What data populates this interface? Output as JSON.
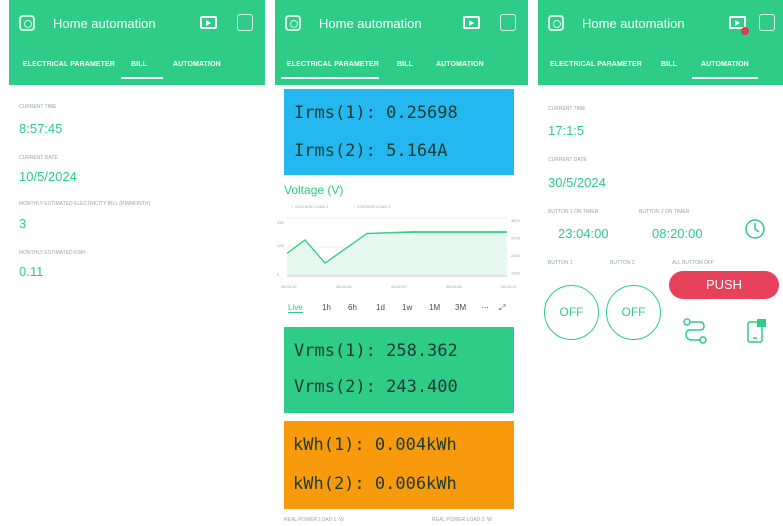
{
  "colors": {
    "accent": "#2ecc87",
    "lcd_blue": "#25b8f0",
    "lcd_green": "#2ecc87",
    "lcd_orange": "#f99a0c",
    "push": "#e8415c"
  },
  "app": {
    "title": "Home automation"
  },
  "tabs": [
    "ELECTRICAL PARAMETER",
    "BILL",
    "AUTOMATION"
  ],
  "bill": {
    "current_time_label": "CURRENT TIME",
    "current_time": "8:57:45",
    "current_date_label": "CURRENT DATE",
    "current_date": "10/5/2024",
    "bill_label": "MONTHLY ESTIMATED ELECTRICITY BILL (RM/MONTH)",
    "bill_value": "3",
    "kwh_label": "MONTHLY ESTIMATED KWH",
    "kwh_value": "0.11"
  },
  "electrical": {
    "irms1": "Irms(1): 0.25698",
    "irms2": "Irms(2): 5.164A",
    "chart_title": "Voltage (V)",
    "legend1": "VOLTAGE LOAD 1",
    "legend2": "VOLTAGE LOAD 2",
    "ranges": [
      "Live",
      "1h",
      "6h",
      "1d",
      "1w",
      "1M",
      "3M"
    ],
    "vrms1": "Vrms(1): 258.362",
    "vrms2": "Vrms(2): 243.400",
    "kwh1": "kWh(1): 0.004kWh",
    "kwh2": "kWh(2): 0.006kWh",
    "power1_label": "REAL POWER LOAD 1: W",
    "power2_label": "REAL POWER LOAD 2: W"
  },
  "chart_data": {
    "type": "line",
    "title": "Voltage (V)",
    "x": [
      "08:42:42",
      "08:42:48",
      "08:42:57",
      "08:43:06",
      "08:43:12"
    ],
    "series": [
      {
        "name": "VOLTAGE LOAD 1",
        "values": [
          215,
          235,
          200,
          246,
          249,
          249,
          249
        ]
      },
      {
        "name": "VOLTAGE LOAD 2",
        "values": [
          215,
          236,
          200,
          246,
          248,
          248,
          248
        ]
      }
    ],
    "yticks_left": [
      "250",
      "125",
      "0"
    ],
    "yticks_right": [
      "4870",
      "3705",
      "2435",
      "1262"
    ]
  },
  "automation": {
    "current_time_label": "CURRENT TIME",
    "current_time": "17:1:5",
    "current_date_label": "CURRENT DATE",
    "current_date": "30/5/2024",
    "timer1_label": "BUTTON 1 ON TIMER",
    "timer1": "23:04:00",
    "timer2_label": "BUTTON 2 ON TIMER",
    "timer2": "08:20:00",
    "button1_label": "BUTTON 1",
    "button2_label": "BUTTON 2",
    "all_off_label": "ALL BUTTON OFF",
    "button1_value": "OFF",
    "button2_value": "OFF",
    "push_label": "PUSH"
  }
}
